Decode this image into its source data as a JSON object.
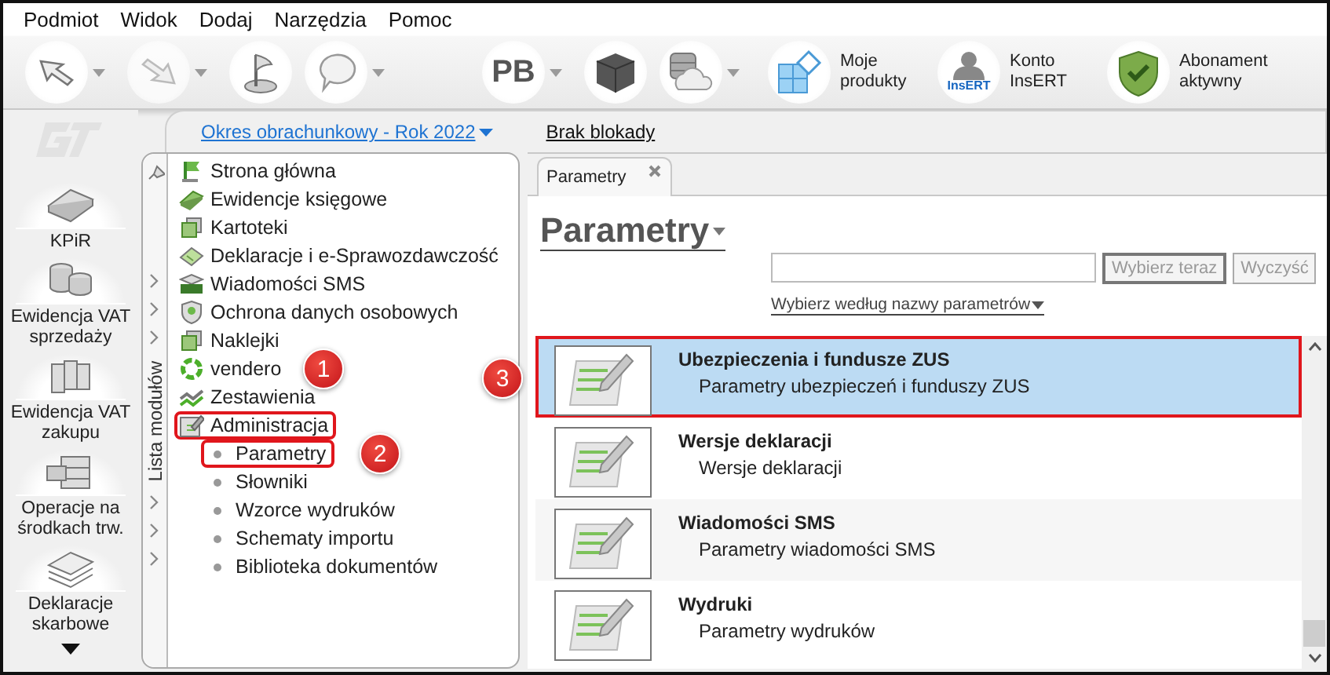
{
  "menu": [
    "Podmiot",
    "Widok",
    "Dodaj",
    "Narzędzia",
    "Pomoc"
  ],
  "toolbar": {
    "left": [
      {
        "kind": "back",
        "dropdown": true,
        "disabled": false
      },
      {
        "kind": "forward",
        "dropdown": true,
        "disabled": true
      },
      {
        "kind": "flag",
        "dropdown": false,
        "disabled": false
      },
      {
        "kind": "help",
        "dropdown": true,
        "disabled": false
      }
    ],
    "right": [
      {
        "kind": "text",
        "text": "PB",
        "dropdown": true
      },
      {
        "kind": "cube",
        "dropdown": false
      },
      {
        "kind": "cloud",
        "dropdown": true
      },
      {
        "kind": "products",
        "label": "Moje produkty"
      },
      {
        "kind": "account",
        "label": "Konto InsERT",
        "logo_text": "InsERT"
      },
      {
        "kind": "shield",
        "label": "Abonament aktywny"
      }
    ]
  },
  "header": {
    "period": "Okres obrachunkowy - Rok 2022",
    "lock_status": "Brak blokady"
  },
  "sidebar": {
    "items": [
      {
        "label": "KPiR",
        "kind": "book"
      },
      {
        "label": "Ewidencja VAT sprzedaży",
        "kind": "coins"
      },
      {
        "label": "Ewidencja VAT zakupu",
        "kind": "binders"
      },
      {
        "label": "Operacje na środkach trw.",
        "kind": "cabinet"
      },
      {
        "label": "Deklaracje skarbowe",
        "kind": "papers"
      }
    ]
  },
  "modules": {
    "title": "Lista modułów",
    "items": [
      {
        "label": "Strona główna",
        "kind": "flag",
        "highlighted": false
      },
      {
        "label": "Ewidencje księgowe",
        "kind": "book",
        "highlighted": false
      },
      {
        "label": "Kartoteki",
        "kind": "cards",
        "highlighted": false
      },
      {
        "label": "Deklaracje i e-Sprawozdawczość",
        "kind": "doc",
        "highlighted": false
      },
      {
        "label": "Wiadomości SMS",
        "kind": "sms",
        "highlighted": false
      },
      {
        "label": "Ochrona danych osobowych",
        "kind": "shield",
        "highlighted": false
      },
      {
        "label": "Naklejki",
        "kind": "cards",
        "highlighted": false
      },
      {
        "label": "vendero",
        "kind": "ring",
        "highlighted": false,
        "badge": "1"
      },
      {
        "label": "Zestawienia",
        "kind": "chart",
        "highlighted": false
      },
      {
        "label": "Administracja",
        "kind": "edit",
        "highlighted": true,
        "children": [
          {
            "label": "Parametry",
            "highlighted": true,
            "badge": "2"
          },
          {
            "label": "Słowniki",
            "highlighted": false
          },
          {
            "label": "Wzorce wydruków",
            "highlighted": false
          },
          {
            "label": "Schematy importu",
            "highlighted": false
          },
          {
            "label": "Biblioteka dokumentów",
            "highlighted": false
          }
        ]
      }
    ]
  },
  "tabs": [
    {
      "label": "Parametry",
      "selected": true,
      "closable": true
    }
  ],
  "page": {
    "title": "Parametry",
    "buttons": [
      {
        "label": "Wybierz teraz",
        "disabled": true,
        "default": true
      },
      {
        "label": "Wyczyść",
        "disabled": true,
        "default": false
      }
    ],
    "filter_link": "Wybierz według nazwy parametrów",
    "rows": [
      {
        "title": "Ubezpieczenia i fundusze ZUS",
        "subtitle": "Parametry ubezpieczeń i funduszy ZUS",
        "selected": true,
        "highlighted": true,
        "badge": "3"
      },
      {
        "title": "Wersje deklaracji",
        "subtitle": "Wersje deklaracji",
        "selected": false,
        "highlighted": false
      },
      {
        "title": "Wiadomości SMS",
        "subtitle": "Parametry wiadomości SMS",
        "selected": false,
        "highlighted": false
      },
      {
        "title": "Wydruki",
        "subtitle": "Parametry wydruków",
        "selected": false,
        "highlighted": false
      }
    ]
  }
}
